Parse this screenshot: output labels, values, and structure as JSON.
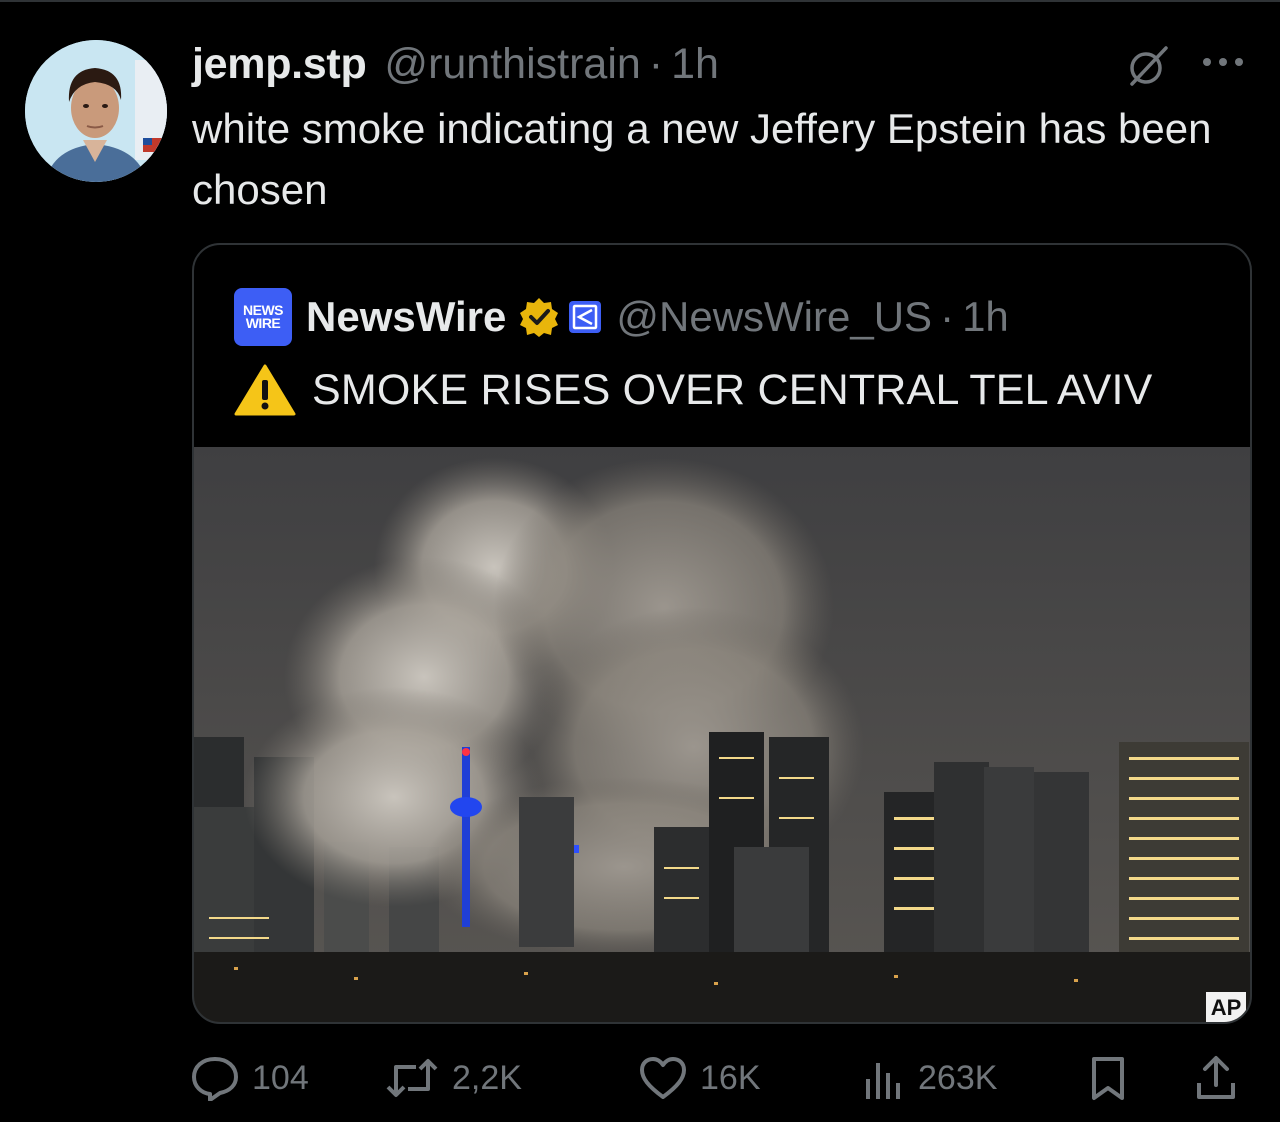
{
  "post": {
    "display_name": "jemp.stp",
    "handle": "@runthistrain",
    "separator": "·",
    "time": "1h",
    "text": "white smoke indicating a new Jeffery Epstein has been chosen",
    "avatar_icon": "profile-photo",
    "more_icon": "ellipsis-icon",
    "grok_icon": "grok-icon"
  },
  "quote": {
    "logo_line1": "NEWS",
    "logo_line2": "WIRE",
    "display_name": "NewsWire",
    "handle": "@NewsWire_US",
    "separator": "·",
    "time": "1h",
    "headline": "SMOKE RISES OVER CENTRAL TEL AVIV",
    "image_credit": "AP",
    "verified_color": "#e8b50b",
    "affiliate_color": "#3d5ef5",
    "warning_color": "#f5c518"
  },
  "actions": {
    "replies": "104",
    "reposts": "2,2K",
    "likes": "16K",
    "views": "263K"
  },
  "colors": {
    "background": "#000000",
    "text_primary": "#e7e9ea",
    "text_secondary": "#71767b",
    "border": "#2f3336"
  }
}
